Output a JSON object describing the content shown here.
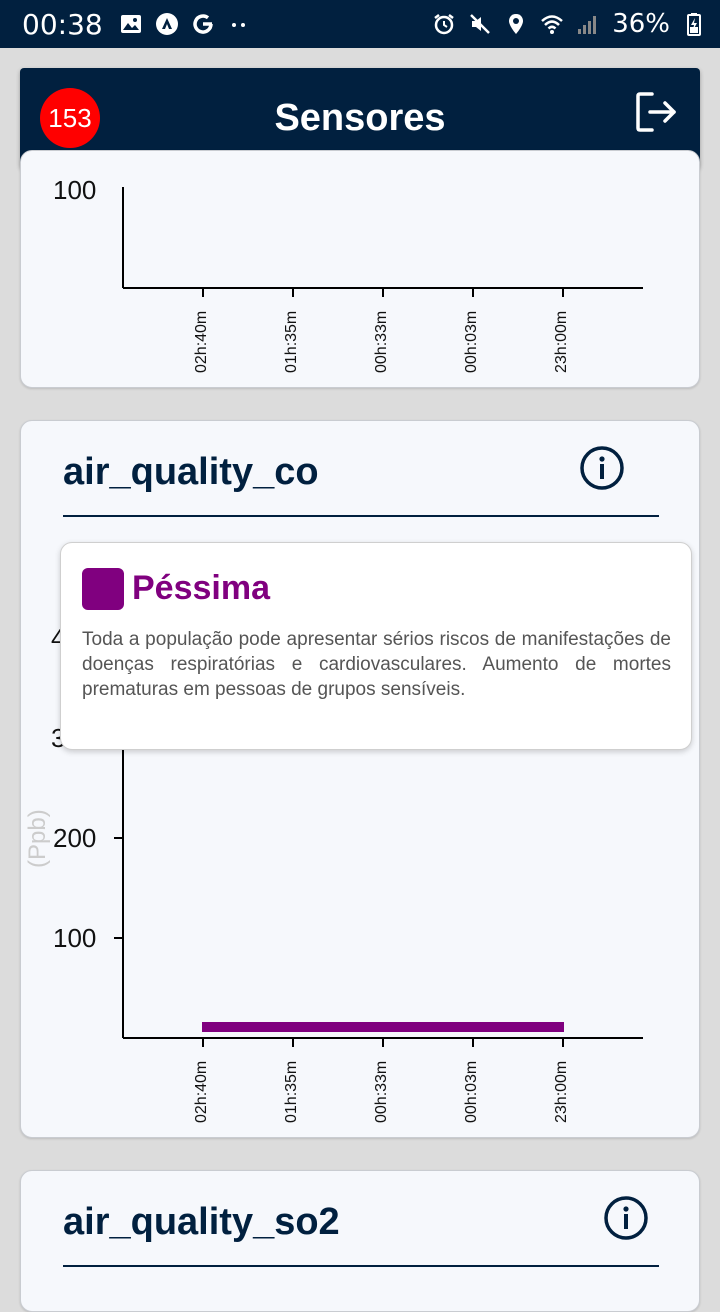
{
  "status_bar": {
    "time": "00:38",
    "battery": "36%",
    "left_icons": [
      "image-icon",
      "arrow-circle-icon",
      "google-icon",
      "more-dots-icon"
    ],
    "right_icons": [
      "alarm-icon",
      "mute-icon",
      "location-icon",
      "wifi-icon",
      "signal-icon",
      "battery-icon"
    ]
  },
  "header": {
    "badge_count": "153",
    "title": "Sensores",
    "logout_icon": "logout-icon"
  },
  "cards": [
    {
      "id": "card-top",
      "x_ticks": [
        "02h:40m",
        "01h:35m",
        "00h:33m",
        "00h:03m",
        "23h:00m"
      ],
      "y_ticks_visible": [
        "100"
      ]
    },
    {
      "id": "air_quality_co",
      "title": "air_quality_co",
      "info_icon": "info-icon",
      "y_unit": "(Ppb)",
      "y_ticks": [
        "4",
        "3",
        "200",
        "100"
      ],
      "x_ticks": [
        "02h:40m",
        "01h:35m",
        "00h:33m",
        "00h:03m",
        "23h:00m"
      ],
      "tooltip": {
        "color": "#80007f",
        "title": "Péssima",
        "description": "Toda a população pode apresentar sérios riscos de manifestações de doenças respiratórias e cardiovasculares. Aumento de mortes prematuras em pessoas de grupos sensíveis."
      }
    },
    {
      "id": "air_quality_so2",
      "title": "air_quality_so2",
      "info_icon": "info-icon"
    }
  ],
  "chart_data": {
    "type": "line",
    "x": [
      "02h:40m",
      "01h:35m",
      "00h:33m",
      "00h:03m",
      "23h:00m"
    ],
    "series": [
      {
        "values": [
          11,
          11,
          11,
          11,
          11
        ],
        "color": "#80007f"
      }
    ],
    "ylabel": "(Ppb)",
    "yticks": [
      100,
      200
    ]
  }
}
